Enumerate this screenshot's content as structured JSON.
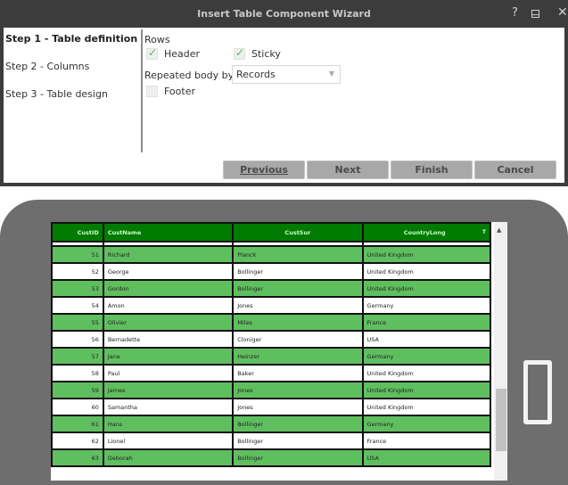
{
  "window": {
    "title": "Insert Table Component Wizard",
    "controls": {
      "help": "?",
      "minimize": "_",
      "close": "✕"
    }
  },
  "steps": [
    {
      "label": "Step 1 - Table definition",
      "active": true
    },
    {
      "label": "Step 2 - Columns",
      "active": false
    },
    {
      "label": "Step 3 - Table design",
      "active": false
    }
  ],
  "form": {
    "rows_label": "Rows",
    "header": {
      "label": "Header",
      "checked": true
    },
    "sticky": {
      "label": "Sticky",
      "checked": true
    },
    "repeated_label": "Repeated body by:",
    "repeated_value": "Records",
    "footer": {
      "label": "Footer",
      "checked": false
    },
    "check_glyph": "✓"
  },
  "buttons": {
    "previous": "Previous",
    "next": "Next",
    "finish": "Finish",
    "cancel": "Cancel"
  },
  "grid": {
    "columns": [
      "CustID",
      "CustName",
      "CustSur",
      "CountryLong"
    ],
    "filter_glyph": "T",
    "scroll_up_glyph": "▲",
    "rows": [
      {
        "id": "51",
        "name": "Richard",
        "sur": "Planck",
        "country": "United Kingdom"
      },
      {
        "id": "52",
        "name": "George",
        "sur": "Bollinger",
        "country": "United Kingdom"
      },
      {
        "id": "53",
        "name": "Gordon",
        "sur": "Bollinger",
        "country": "United Kingdom"
      },
      {
        "id": "54",
        "name": "Amon",
        "sur": "Jones",
        "country": "Germany"
      },
      {
        "id": "55",
        "name": "Olivier",
        "sur": "Miles",
        "country": "France"
      },
      {
        "id": "56",
        "name": "Bernadette",
        "sur": "Cloniger",
        "country": "USA"
      },
      {
        "id": "57",
        "name": "Jane",
        "sur": "Heinzer",
        "country": "Germany"
      },
      {
        "id": "58",
        "name": "Paul",
        "sur": "Baker",
        "country": "United Kingdom"
      },
      {
        "id": "59",
        "name": "James",
        "sur": "Jones",
        "country": "United Kingdom"
      },
      {
        "id": "60",
        "name": "Samantha",
        "sur": "Jones",
        "country": "United Kingdom"
      },
      {
        "id": "61",
        "name": "Hans",
        "sur": "Bollinger",
        "country": "Germany"
      },
      {
        "id": "62",
        "name": "Lionel",
        "sur": "Bollinger",
        "country": "France"
      },
      {
        "id": "63",
        "name": "Deborah",
        "sur": "Bollinger",
        "country": "USA"
      }
    ]
  },
  "colors": {
    "titlebar": "#3c3c3c",
    "header_green": "#007a00",
    "row_green": "#5fbf5f",
    "check_green": "#5cb85c",
    "button_gray": "#a8a8a8",
    "phone_gray": "#6e6e6e"
  }
}
